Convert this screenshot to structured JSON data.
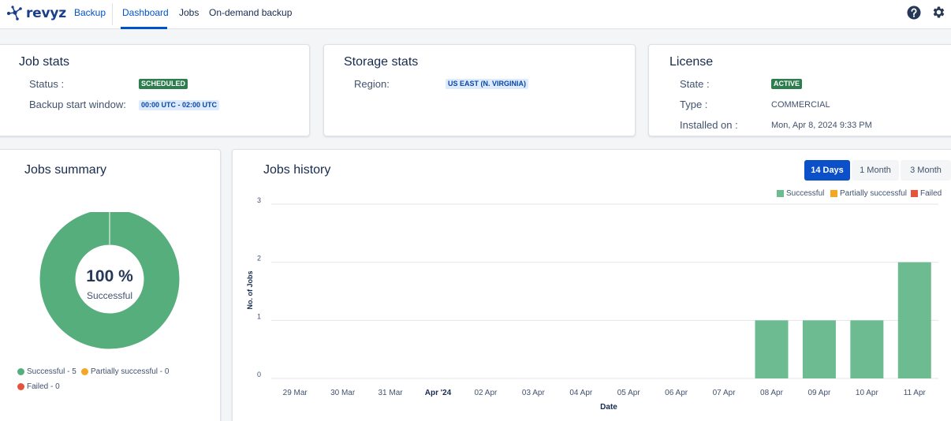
{
  "nav": {
    "logo_text": "revyz",
    "backup": "Backup",
    "dashboard": "Dashboard",
    "jobs": "Jobs",
    "on_demand": "On-demand backup",
    "help_icon": "question-circle-icon",
    "settings_icon": "gear-icon"
  },
  "job_stats": {
    "title": "Job stats",
    "status_label": "Status :",
    "status_value": "SCHEDULED",
    "window_label": "Backup start window:",
    "window_value": "00:00 UTC - 02:00 UTC"
  },
  "storage_stats": {
    "title": "Storage stats",
    "region_label": "Region:",
    "region_value": "US EAST (N. VIRGINIA)"
  },
  "license": {
    "title": "License",
    "state_label": "State :",
    "state_value": "ACTIVE",
    "type_label": "Type :",
    "type_value": "COMMERCIAL",
    "installed_label": "Installed on :",
    "installed_value": "Mon, Apr 8, 2024 9:33 PM"
  },
  "jobs_summary": {
    "title": "Jobs summary",
    "center_value": "100 %",
    "center_label": "Successful",
    "legend": [
      {
        "label": "Successful - 5",
        "color": "#57ae7d"
      },
      {
        "label": "Partially successful - 0",
        "color": "#f5a623"
      },
      {
        "label": "Failed - 0",
        "color": "#e5533d"
      }
    ],
    "chart_data": {
      "type": "pie",
      "categories": [
        "Successful",
        "Partially successful",
        "Failed"
      ],
      "values": [
        5,
        0,
        0
      ]
    }
  },
  "jobs_history": {
    "title": "Jobs history",
    "ranges": [
      "14 Days",
      "1 Month",
      "3 Month"
    ],
    "active_range": "14 Days",
    "legend": [
      {
        "label": "Successful",
        "color": "#6cbb91"
      },
      {
        "label": "Partially successful",
        "color": "#f5a623"
      },
      {
        "label": "Failed",
        "color": "#e5533d"
      }
    ]
  },
  "chart_data": {
    "type": "bar",
    "title": "Jobs history",
    "xlabel": "Date",
    "ylabel": "No. of Jobs",
    "ylim": [
      0,
      3
    ],
    "yticks": [
      "0",
      "1",
      "2",
      "3"
    ],
    "categories": [
      "29 Mar",
      "30 Mar",
      "31 Mar",
      "Apr '24",
      "02 Apr",
      "03 Apr",
      "04 Apr",
      "05 Apr",
      "06 Apr",
      "07 Apr",
      "08 Apr",
      "09 Apr",
      "10 Apr",
      "11 Apr"
    ],
    "bold_categories": [
      "Apr '24"
    ],
    "series": [
      {
        "name": "Successful",
        "color": "#6cbb91",
        "values": [
          0,
          0,
          0,
          0,
          0,
          0,
          0,
          0,
          0,
          0,
          1,
          1,
          1,
          2
        ]
      },
      {
        "name": "Partially successful",
        "color": "#f5a623",
        "values": [
          0,
          0,
          0,
          0,
          0,
          0,
          0,
          0,
          0,
          0,
          0,
          0,
          0,
          0
        ]
      },
      {
        "name": "Failed",
        "color": "#e5533d",
        "values": [
          0,
          0,
          0,
          0,
          0,
          0,
          0,
          0,
          0,
          0,
          0,
          0,
          0,
          0
        ]
      }
    ],
    "grid": true,
    "legend_position": "top-right"
  }
}
